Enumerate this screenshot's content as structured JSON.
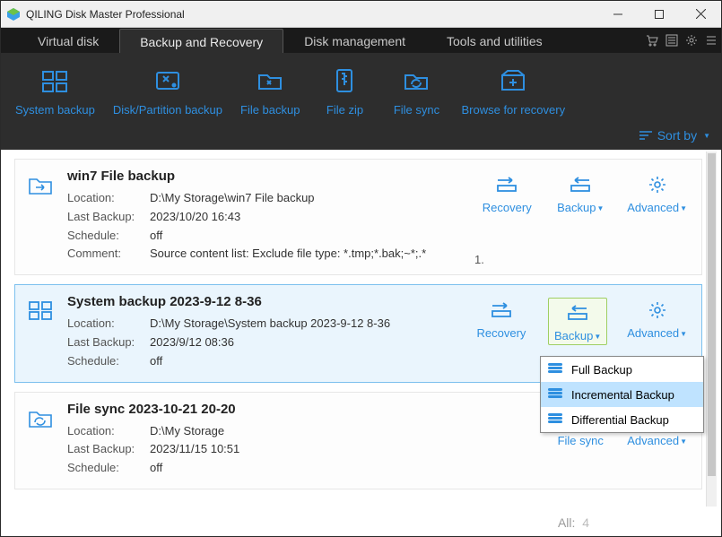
{
  "window": {
    "title": "QILING Disk Master Professional"
  },
  "menu": {
    "tabs": [
      "Virtual disk",
      "Backup and Recovery",
      "Disk management",
      "Tools and utilities"
    ],
    "active_index": 1
  },
  "toolbar": {
    "items": [
      {
        "label": "System backup"
      },
      {
        "label": "Disk/Partition backup"
      },
      {
        "label": "File backup"
      },
      {
        "label": "File zip"
      },
      {
        "label": "File sync"
      },
      {
        "label": "Browse for recovery"
      }
    ],
    "sort_label": "Sort by"
  },
  "cards": [
    {
      "title": "win7 File backup",
      "location_label": "Location:",
      "location": "D:\\My Storage\\win7 File backup",
      "last_label": "Last Backup:",
      "last": "2023/10/20 16:43",
      "sched_label": "Schedule:",
      "sched": "off",
      "comment_label": "Comment:",
      "comment": "Source content list:  Exclude file type: *.tmp;*.bak;~*;.*",
      "extra": "1.",
      "actions": {
        "recovery": "Recovery",
        "backup": "Backup",
        "advanced": "Advanced"
      }
    },
    {
      "title": "System backup 2023-9-12 8-36",
      "location_label": "Location:",
      "location": "D:\\My Storage\\System backup 2023-9-12 8-36",
      "last_label": "Last Backup:",
      "last": "2023/9/12 08:36",
      "sched_label": "Schedule:",
      "sched": "off",
      "actions": {
        "recovery": "Recovery",
        "backup": "Backup",
        "advanced": "Advanced"
      }
    },
    {
      "title": "File sync 2023-10-21 20-20",
      "location_label": "Location:",
      "location": "D:\\My Storage",
      "last_label": "Last Backup:",
      "last": "2023/11/15 10:51",
      "sched_label": "Schedule:",
      "sched": "off",
      "actions": {
        "filesync": "File sync",
        "advanced": "Advanced"
      }
    }
  ],
  "backup_menu": {
    "items": [
      "Full Backup",
      "Incremental Backup",
      "Differential Backup"
    ],
    "highlight_index": 1
  },
  "footer": {
    "label": "All:",
    "count": "4"
  }
}
